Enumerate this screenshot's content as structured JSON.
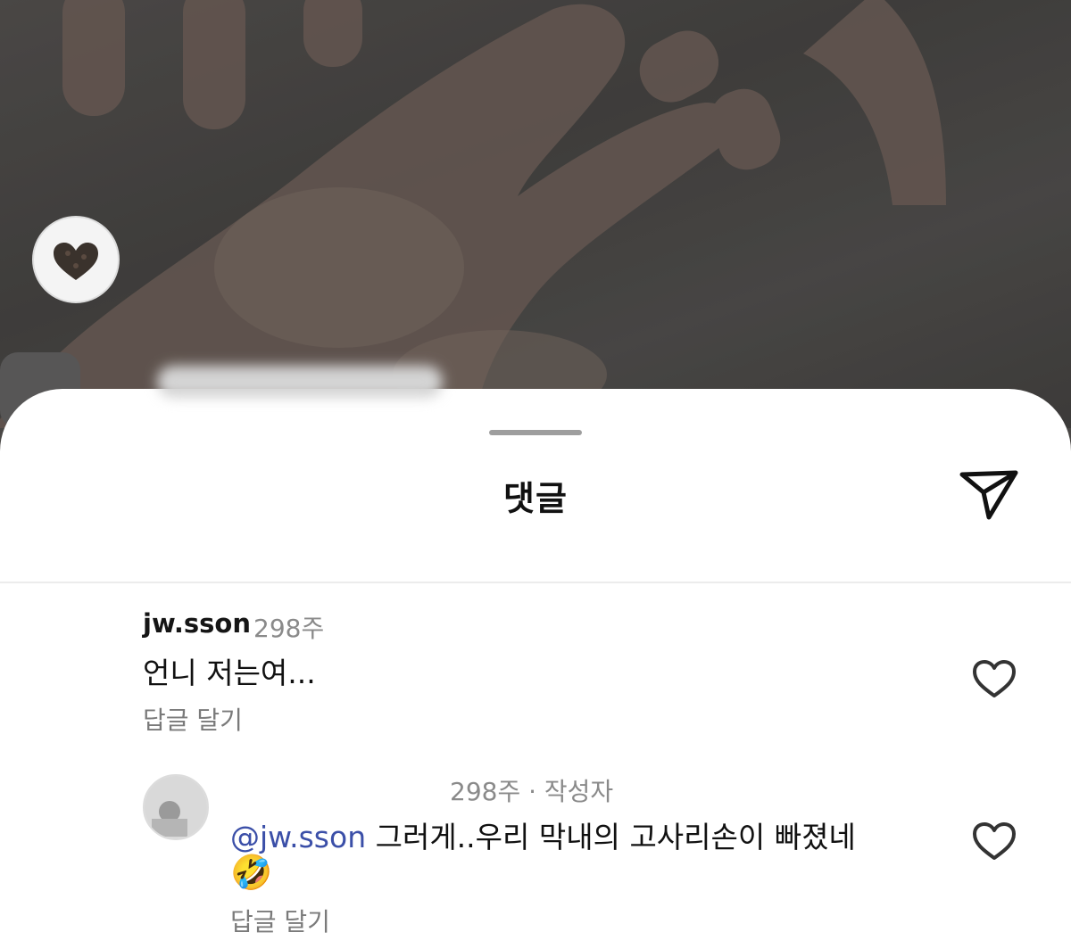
{
  "sheet": {
    "title": "댓글",
    "share_icon": "paper-plane-icon"
  },
  "comments": [
    {
      "username": "jw.sson",
      "time": "298주",
      "text": "언니 저는여...",
      "reply_label": "답글 달기",
      "like_icon": "heart-outline-icon"
    },
    {
      "time_meta": "298주 · 작성자",
      "mention": "@jw.sson",
      "text": " 그러게..우리 막내의 고사리손이 빠졌네",
      "emoji": "🤣",
      "reply_label": "답글 달기",
      "like_icon": "heart-outline-icon"
    }
  ]
}
